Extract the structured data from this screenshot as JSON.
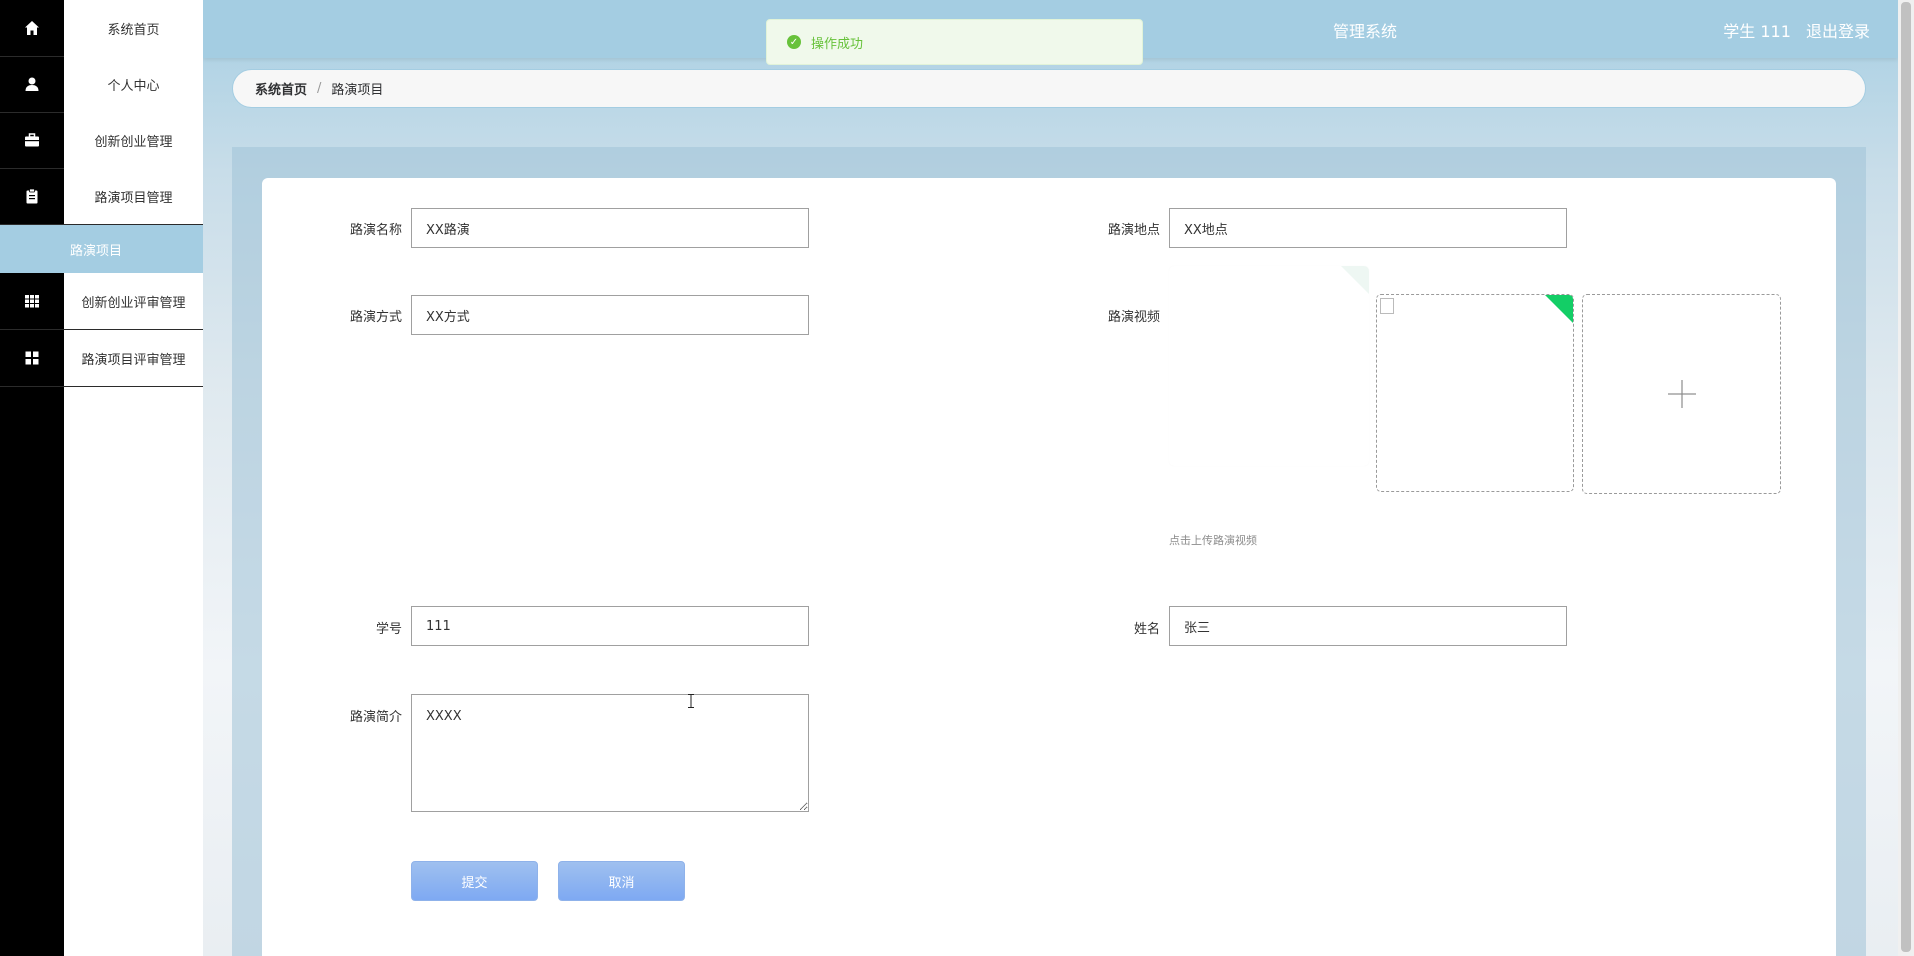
{
  "sidebar": {
    "items": [
      {
        "label": "系统首页",
        "icon": "home-icon"
      },
      {
        "label": "个人中心",
        "icon": "user-icon"
      },
      {
        "label": "创新创业管理",
        "icon": "briefcase-icon"
      },
      {
        "label": "路演项目管理",
        "icon": "clipboard-icon"
      },
      {
        "label": "创新创业评审管理",
        "icon": "grid-icon"
      },
      {
        "label": "路演项目评审管理",
        "icon": "apps-icon"
      }
    ],
    "active_sub": "路演项目"
  },
  "header": {
    "title": "管理系统",
    "user_label": "学生 111",
    "logout_label": "退出登录"
  },
  "toast": {
    "message": "操作成功"
  },
  "breadcrumb": {
    "home": "系统首页",
    "separator": "/",
    "current": "路演项目"
  },
  "form": {
    "name": {
      "label": "路演名称",
      "value": "XX路演"
    },
    "location": {
      "label": "路演地点",
      "value": "XX地点"
    },
    "method": {
      "label": "路演方式",
      "value": "XX方式"
    },
    "video": {
      "label": "路演视频",
      "hint": "点击上传路演视频"
    },
    "student_id": {
      "label": "学号",
      "value": "111"
    },
    "student_name": {
      "label": "姓名",
      "value": "张三"
    },
    "intro": {
      "label": "路演简介",
      "value": "XXXX"
    },
    "submit_label": "提交",
    "cancel_label": "取消"
  },
  "colors": {
    "accent": "#a4cde2",
    "success": "#67c23a",
    "corner": "#13ce66",
    "button": "#7ea9f2"
  }
}
